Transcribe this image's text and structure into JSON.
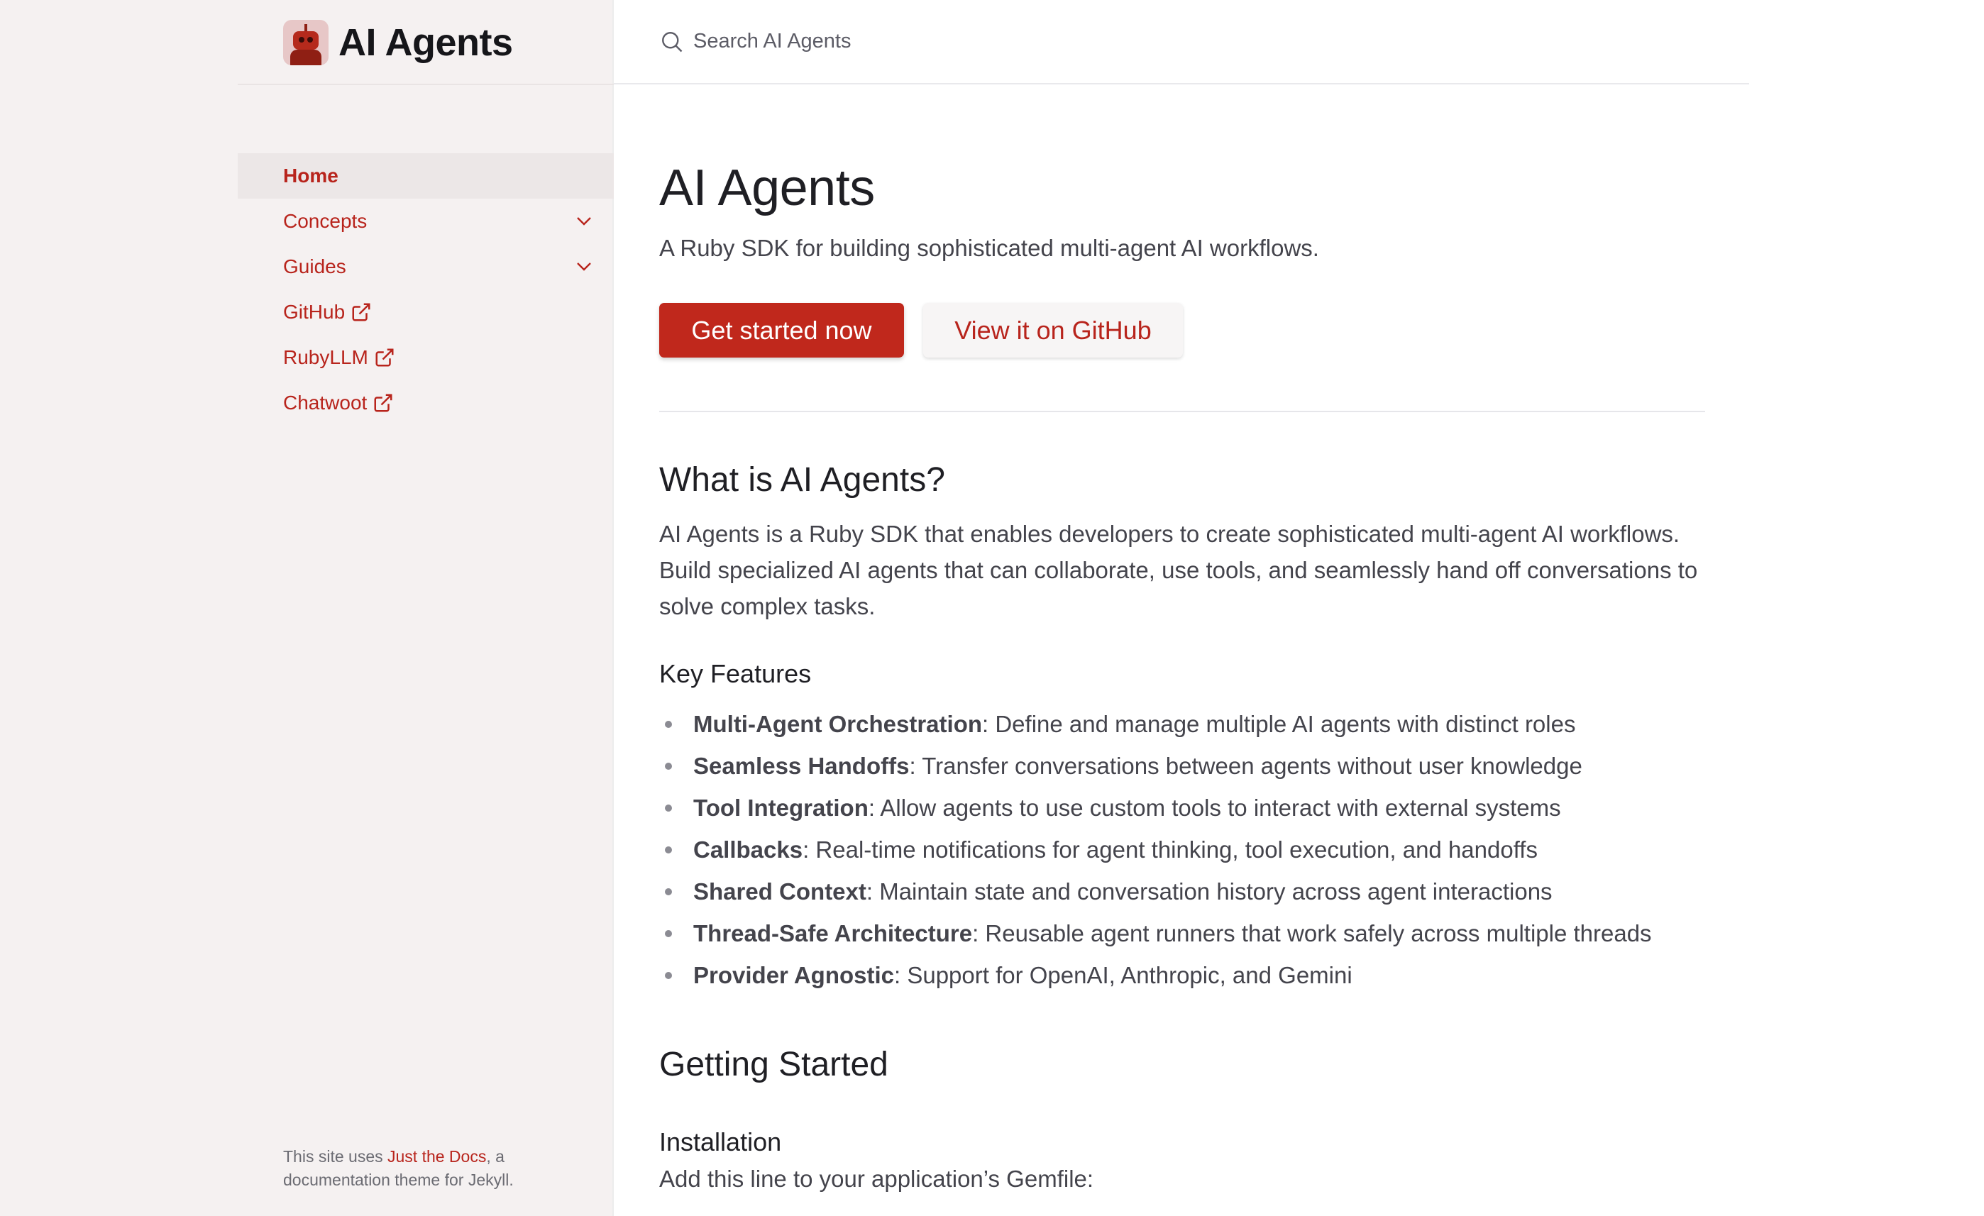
{
  "colors": {
    "accent": "#c0281c",
    "link": "#b8241c",
    "sidebar_bg": "#f5f1f1"
  },
  "site": {
    "title": "AI Agents",
    "logo_icon": "robot-icon"
  },
  "search": {
    "placeholder": "Search AI Agents",
    "icon": "search-icon"
  },
  "nav": {
    "items": [
      {
        "label": "Home",
        "active": true
      },
      {
        "label": "Concepts",
        "expandable": true
      },
      {
        "label": "Guides",
        "expandable": true
      },
      {
        "label": "GitHub",
        "external": true
      },
      {
        "label": "RubyLLM",
        "external": true
      },
      {
        "label": "Chatwoot",
        "external": true
      }
    ]
  },
  "footer": {
    "prefix": "This site uses ",
    "link": "Just the Docs",
    "suffix": ", a documentation theme for Jekyll."
  },
  "main": {
    "title": "AI Agents",
    "lead": "A Ruby SDK for building sophisticated multi-agent AI workflows.",
    "primary_button": "Get started now",
    "secondary_button": "View it on GitHub",
    "what_heading": "What is AI Agents?",
    "what_text": "AI Agents is a Ruby SDK that enables developers to create sophisticated multi-agent AI workflows. Build specialized AI agents that can collaborate, use tools, and seamlessly hand off conversations to solve complex tasks.",
    "features_heading": "Key Features",
    "features": [
      {
        "name": "Multi-Agent Orchestration",
        "desc": ": Define and manage multiple AI agents with distinct roles"
      },
      {
        "name": "Seamless Handoffs",
        "desc": ": Transfer conversations between agents without user knowledge"
      },
      {
        "name": "Tool Integration",
        "desc": ": Allow agents to use custom tools to interact with external systems"
      },
      {
        "name": "Callbacks",
        "desc": ": Real-time notifications for agent thinking, tool execution, and handoffs"
      },
      {
        "name": "Shared Context",
        "desc": ": Maintain state and conversation history across agent interactions"
      },
      {
        "name": "Thread-Safe Architecture",
        "desc": ": Reusable agent runners that work safely across multiple threads"
      },
      {
        "name": "Provider Agnostic",
        "desc": ": Support for OpenAI, Anthropic, and Gemini"
      }
    ],
    "getting_started_heading": "Getting Started",
    "installation_heading": "Installation",
    "installation_text": "Add this line to your application’s Gemfile:"
  }
}
